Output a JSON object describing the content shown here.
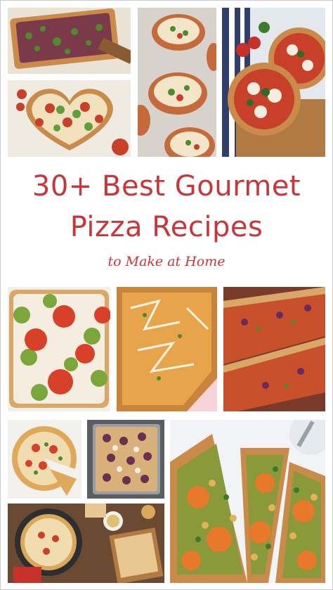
{
  "title": {
    "line1": "30+ Best Gourmet",
    "line2": "Pizza Recipes",
    "subtitle": "to Make at Home"
  },
  "colors": {
    "title": "#c8363a",
    "crust": "#c98a4a",
    "sauce": "#c8402a",
    "cheese": "#f3e6c8",
    "basil": "#4f8a2f",
    "pesto": "#7aa63a",
    "board": "#9a6a3a"
  },
  "photos": [
    {
      "name": "flatbread-pizza-photo"
    },
    {
      "name": "mini-pizzas-photo"
    },
    {
      "name": "margherita-pizza-photo"
    },
    {
      "name": "heart-pizza-photo"
    },
    {
      "name": "pesto-tomato-pizza-photo"
    },
    {
      "name": "buffalo-chicken-pizza-photo"
    },
    {
      "name": "bbq-onion-pizza-photo"
    },
    {
      "name": "cauliflower-crust-pizza-photo"
    },
    {
      "name": "fig-sheet-pizza-photo"
    },
    {
      "name": "squash-chickpea-pizza-photo"
    },
    {
      "name": "table-spread-photo"
    }
  ]
}
